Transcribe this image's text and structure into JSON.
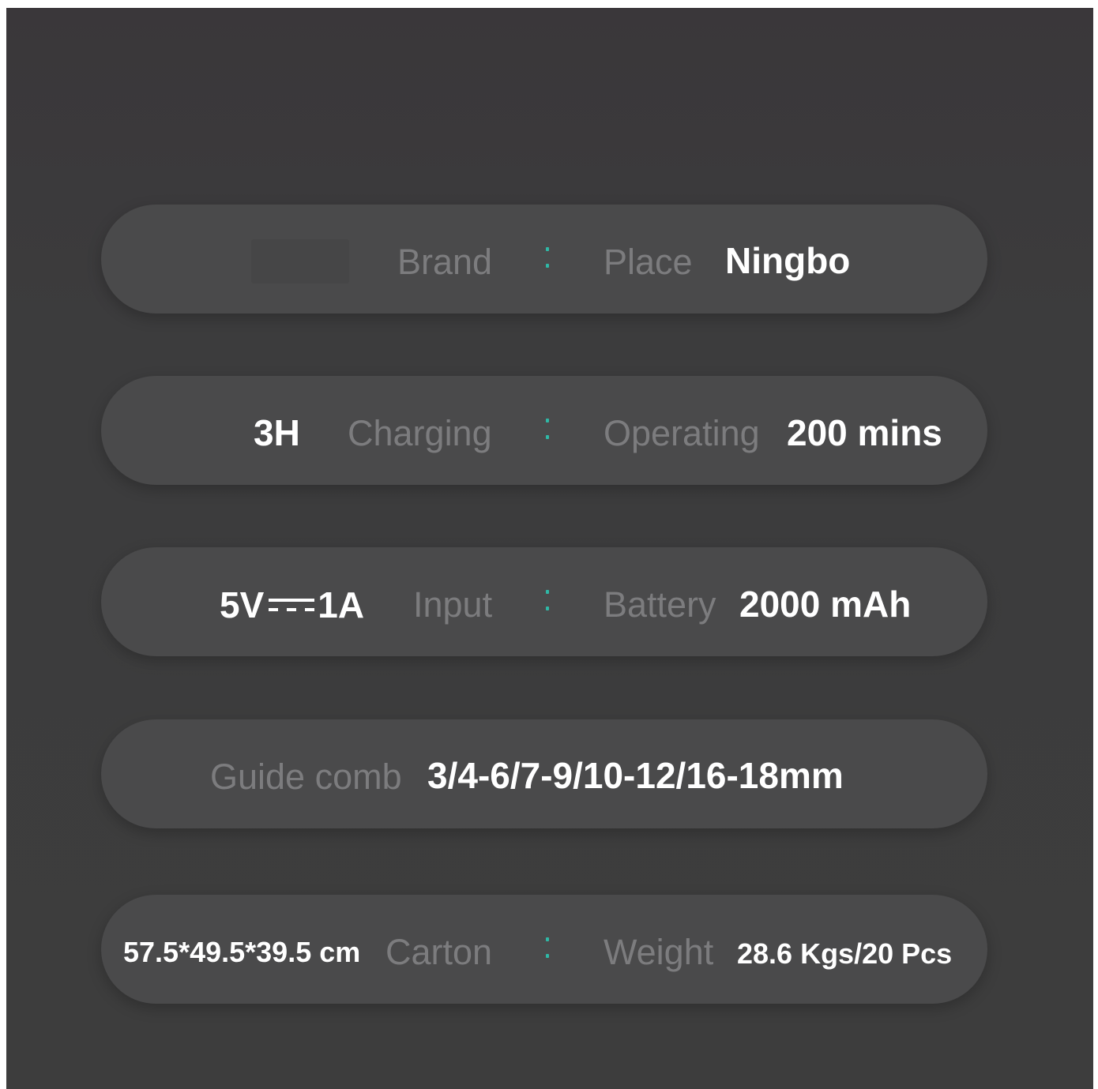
{
  "accent_color": "#2fb8a6",
  "rows": [
    {
      "value_left": "",
      "label_left": "Brand",
      "label_right": "Place",
      "value_right": "Ningbo"
    },
    {
      "value_left": "3H",
      "label_left": "Charging",
      "label_right": "Operating",
      "value_right": "200 mins"
    },
    {
      "value_left_prefix": "5V",
      "value_left_suffix": "1A",
      "value_left_icon": "dc-current-symbol",
      "label_left": "Input",
      "label_right": "Battery",
      "value_right": "2000 mAh"
    },
    {
      "label": "Guide comb",
      "value": "3/4-6/7-9/10-12/16-18mm"
    },
    {
      "value_left": "57.5*49.5*39.5 cm",
      "label_left": "Carton",
      "label_right": "Weight",
      "value_right": "28.6 Kgs/20 Pcs"
    }
  ]
}
